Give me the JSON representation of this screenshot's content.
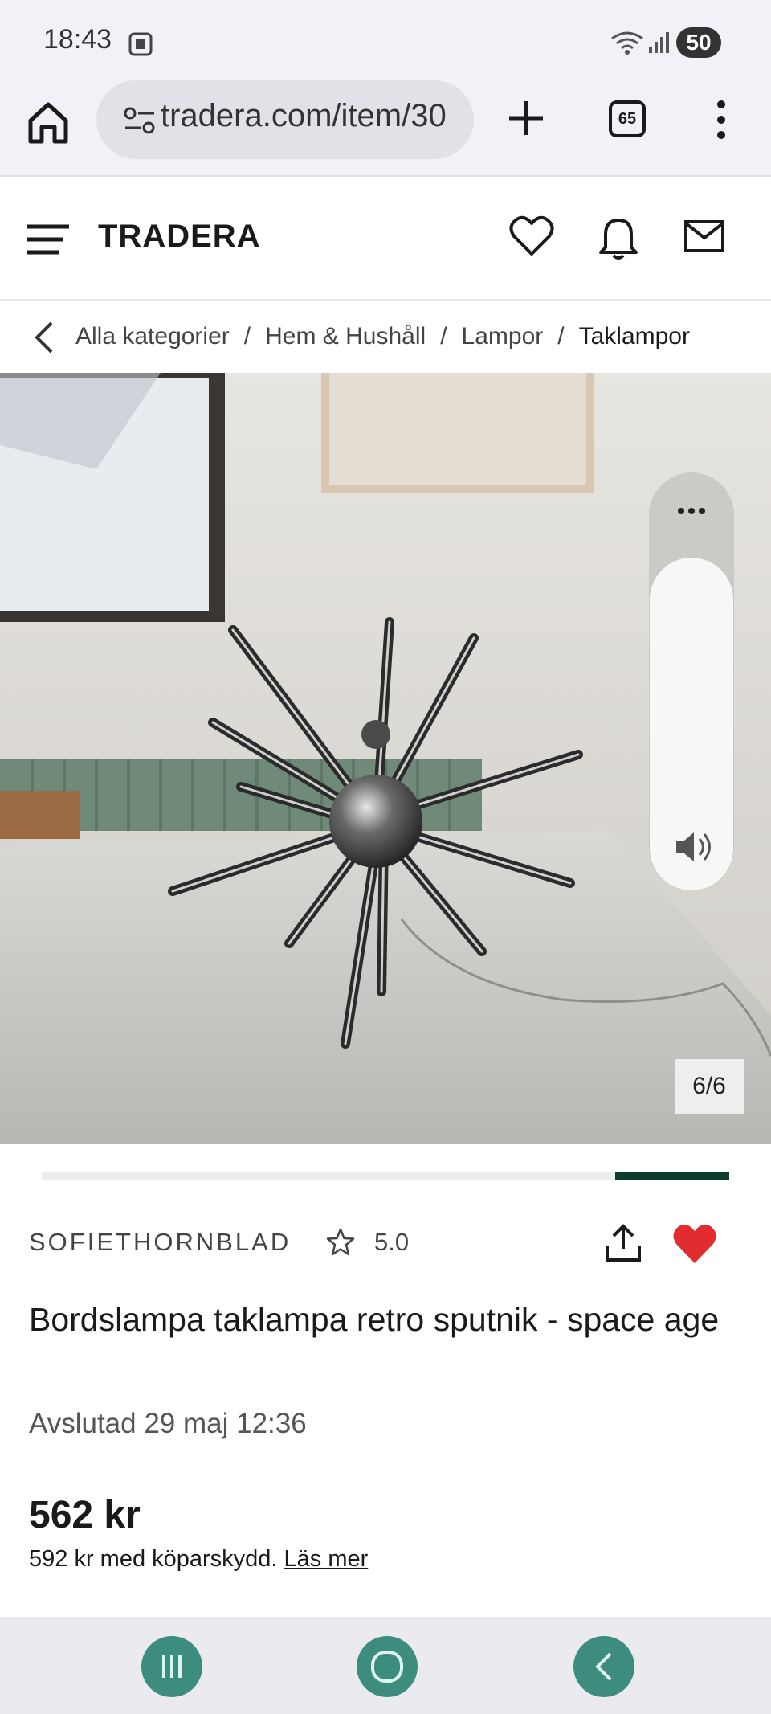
{
  "status_bar": {
    "time": "18:43",
    "battery": "50",
    "icons": [
      "screenshot-icon",
      "wifi-icon",
      "signal-icon"
    ]
  },
  "browser": {
    "url": "tradera.com/item/30",
    "tab_count": "65",
    "icons": [
      "home-icon",
      "site-settings-icon",
      "plus-icon",
      "tabs-icon",
      "more-vert-icon"
    ]
  },
  "site_header": {
    "logo": "TRADERA",
    "icons": [
      "menu-icon",
      "heart-icon",
      "bell-icon",
      "mail-icon"
    ]
  },
  "breadcrumb": {
    "items": [
      "Alla kategorier",
      "Hem & Hushåll",
      "Lampor",
      "Taklampor"
    ],
    "separator": "/"
  },
  "gallery": {
    "counter": "6/6",
    "progress": 0.834,
    "volume_menu": "⋯"
  },
  "listing": {
    "seller": "SOFIETHORNBLAD",
    "rating": "5.0",
    "title": "Bordslampa taklampa retro sputnik - space age",
    "end_status": "Avslutad 29 maj 12:36",
    "price": "562 kr",
    "protection_text": "592 kr med köparskydd.",
    "protection_link": "Läs mer",
    "favorited": true
  },
  "colors": {
    "accent": "#0e3b2e",
    "heart": "#e12d2d",
    "nav_button": "#3d8d7f"
  }
}
